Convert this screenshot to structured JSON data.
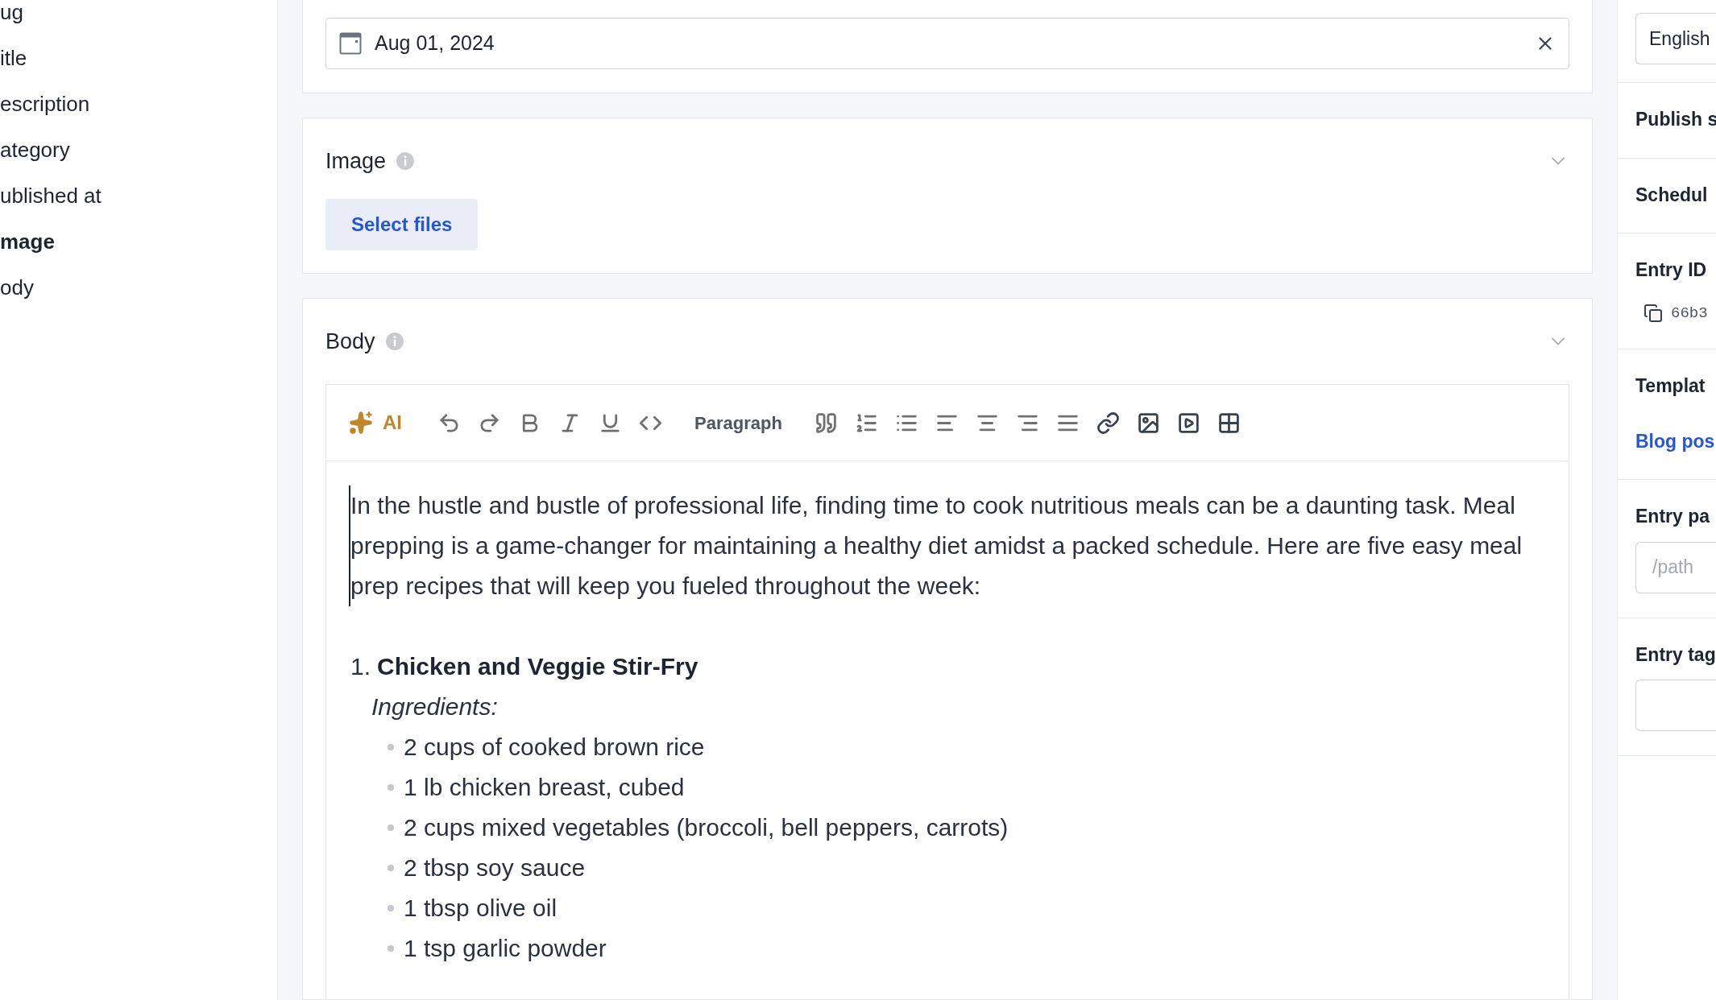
{
  "outline": {
    "items": [
      {
        "label": "ug",
        "selected": false
      },
      {
        "label": "itle",
        "selected": false
      },
      {
        "label": "escription",
        "selected": false
      },
      {
        "label": "ategory",
        "selected": false
      },
      {
        "label": "ublished at",
        "selected": false
      },
      {
        "label": "mage",
        "selected": true
      },
      {
        "label": "ody",
        "selected": false
      }
    ]
  },
  "date_field": {
    "value": "Aug 01, 2024"
  },
  "image_section": {
    "title": "Image",
    "expanded": true,
    "button": "Select files"
  },
  "body_section": {
    "title": "Body",
    "expanded": true,
    "ai_label": "AI",
    "block_type": "Paragraph",
    "paragraph": "In the hustle and bustle of professional life, finding time to cook nutritious meals can be a daunting task. Meal prepping is a game-changer for maintaining a healthy diet amidst a packed schedule. Here are five easy meal prep recipes that will keep you fueled throughout the week:",
    "recipes": [
      {
        "number": "1.",
        "title": "Chicken and Veggie Stir-Fry",
        "subheading": "Ingredients:",
        "items": [
          "2 cups of cooked brown rice",
          "1 lb chicken breast, cubed",
          "2 cups mixed vegetables (broccoli, bell peppers, carrots)",
          "2 tbsp soy sauce",
          "1 tbsp olive oil",
          "1 tsp garlic powder"
        ]
      }
    ]
  },
  "side_panel": {
    "locale": "English",
    "sections": [
      {
        "kind": "heading",
        "title": "Publish s"
      },
      {
        "kind": "heading",
        "title": "Schedul"
      },
      {
        "kind": "id",
        "title": "Entry ID",
        "value": "66b3"
      },
      {
        "kind": "link",
        "title": "Templat",
        "link": "Blog pos"
      },
      {
        "kind": "input",
        "title": "Entry pa",
        "placeholder": "/path"
      },
      {
        "kind": "input",
        "title": "Entry tag"
      }
    ]
  }
}
